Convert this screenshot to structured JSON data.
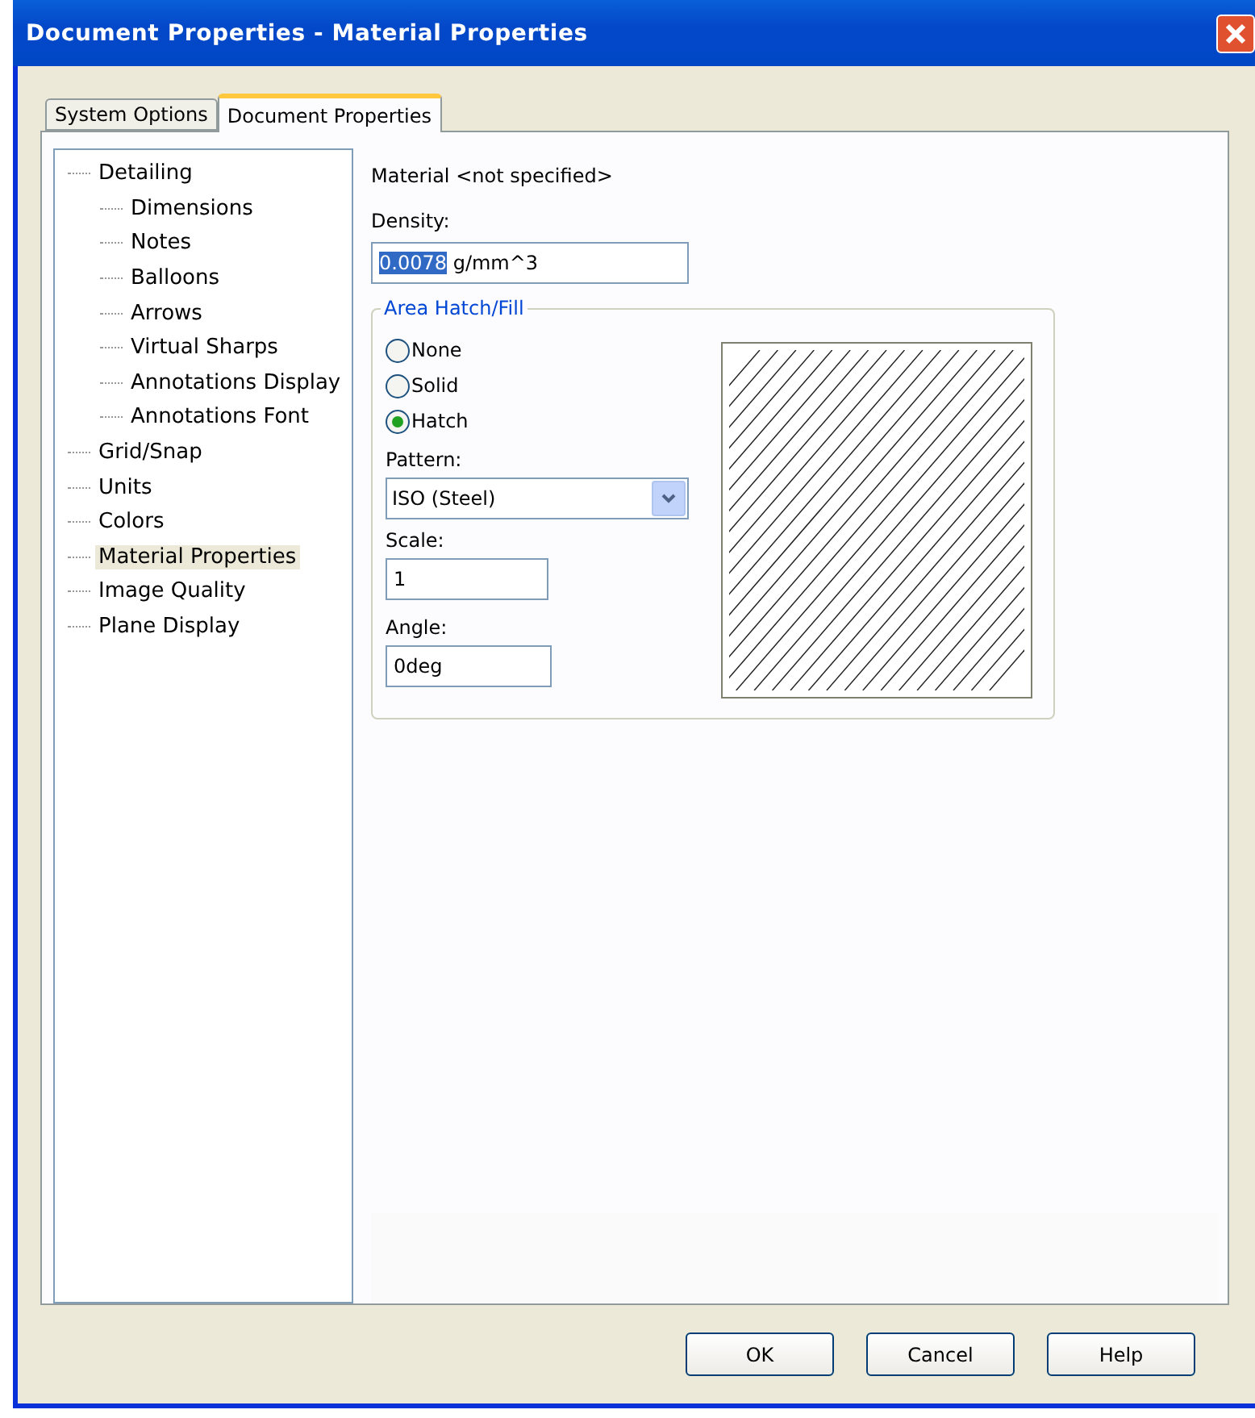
{
  "window": {
    "title": "Document Properties - Material Properties"
  },
  "tabs": [
    {
      "label": "System Options",
      "selected": false
    },
    {
      "label": "Document Properties",
      "selected": true
    }
  ],
  "tree": [
    {
      "label": "Detailing",
      "selected": false,
      "children": [
        {
          "label": "Dimensions",
          "selected": false
        },
        {
          "label": "Notes",
          "selected": false
        },
        {
          "label": "Balloons",
          "selected": false
        },
        {
          "label": "Arrows",
          "selected": false
        },
        {
          "label": "Virtual Sharps",
          "selected": false
        },
        {
          "label": "Annotations Display",
          "selected": false
        },
        {
          "label": "Annotations Font",
          "selected": false
        }
      ]
    },
    {
      "label": "Grid/Snap",
      "selected": false
    },
    {
      "label": "Units",
      "selected": false
    },
    {
      "label": "Colors",
      "selected": false
    },
    {
      "label": "Material Properties",
      "selected": true
    },
    {
      "label": "Image Quality",
      "selected": false
    },
    {
      "label": "Plane Display",
      "selected": false
    }
  ],
  "material": "Material <not specified>",
  "density": {
    "label": "Density:",
    "value": "0.0078",
    "value_selected": true,
    "unit": "g/mm^3"
  },
  "area_hatch": {
    "title": "Area Hatch/Fill",
    "options": [
      {
        "label": "None",
        "selected": false
      },
      {
        "label": "Solid",
        "selected": false
      },
      {
        "label": "Hatch",
        "selected": true
      }
    ],
    "pattern": {
      "label": "Pattern:",
      "value": "ISO (Steel)"
    },
    "scale": {
      "label": "Scale:",
      "value": "1"
    },
    "angle": {
      "label": "Angle:",
      "value": "0deg"
    }
  },
  "buttons": [
    "OK",
    "Cancel",
    "Help"
  ]
}
